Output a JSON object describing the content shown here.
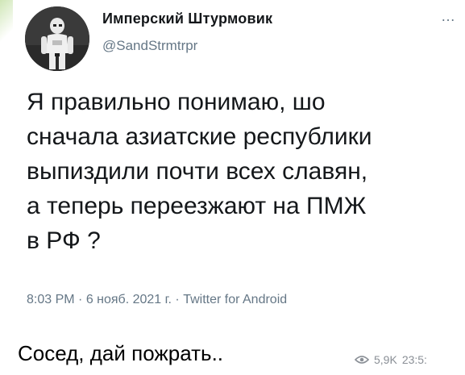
{
  "tweet": {
    "author_name": "Имперский Штурмовик",
    "author_handle": "@SandStrmtrpr",
    "more_glyph": "…",
    "text": "Я правильно понимаю, шо\nсначала азиатские республики\nвыпиздили почти всех славян,\nа теперь переезжают на ПМЖ\nв РФ ?",
    "time": "8:03 PM",
    "date": "6 нояб. 2021 г.",
    "source": "Twitter for Android",
    "separator": " · "
  },
  "message": {
    "caption": "Сосед, дай пожрать..",
    "views": "5,9K",
    "timestamp": "23:5:"
  },
  "colors": {
    "text_primary": "#14171a",
    "text_secondary": "#657786",
    "accent_corner": "#cfe6b6"
  },
  "icons": {
    "avatar": "stormtrooper-avatar",
    "views": "eye-icon"
  }
}
